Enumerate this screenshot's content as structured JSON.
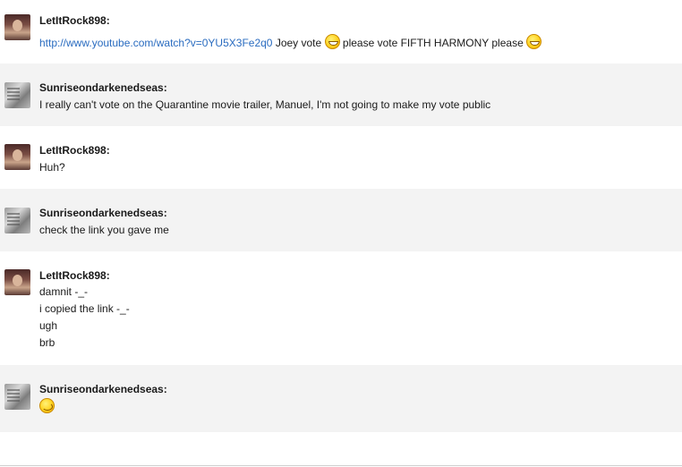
{
  "messages": [
    {
      "sender": "LetItRock898:",
      "avatar": "avatar-letitrock898",
      "lines": [
        {
          "link": "http://www.youtube.com/watch?v=0YU5X3Fe2q0",
          "text1": "Joey vote",
          "emoticon1": "grin-emoticon",
          "text2": "please vote FIFTH HARMONY please",
          "emoticon2": "grin-emoticon"
        }
      ]
    },
    {
      "sender": "Sunriseondarkenedseas:",
      "avatar": "avatar-sunriseondarkenedseas",
      "lines": [
        "I really can't vote on the Quarantine movie trailer, Manuel, I'm not going to make my vote public"
      ]
    },
    {
      "sender": "LetItRock898:",
      "avatar": "avatar-letitrock898",
      "lines": [
        "Huh?"
      ]
    },
    {
      "sender": "Sunriseondarkenedseas:",
      "avatar": "avatar-sunriseondarkenedseas",
      "lines": [
        "check the link you gave me"
      ]
    },
    {
      "sender": "LetItRock898:",
      "avatar": "avatar-letitrock898",
      "lines": [
        "damnit -_-",
        "i copied the link -_-",
        "ugh",
        "brb"
      ]
    },
    {
      "sender": "Sunriseondarkenedseas:",
      "avatar": "avatar-sunriseondarkenedseas",
      "emoticon": "wink-emoticon"
    }
  ],
  "colors": {
    "alt_row_bg": "#f3f3f3",
    "link": "#2a6cc0",
    "text": "#1a1a1a"
  }
}
